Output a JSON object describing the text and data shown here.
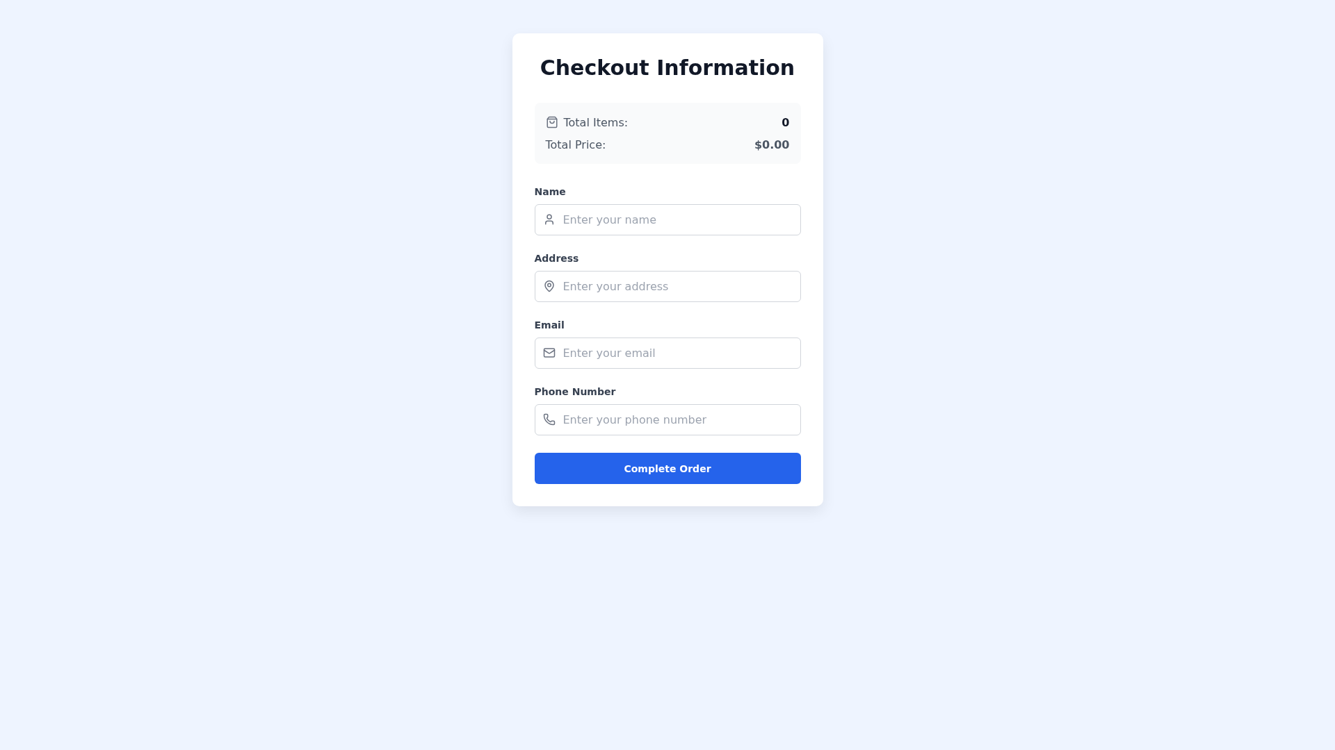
{
  "title": "Checkout Information",
  "summary": [
    {
      "kind": "items",
      "label": "Total Items:",
      "value": "0"
    },
    {
      "kind": "price",
      "label": "Total Price:",
      "value": "$0.00"
    }
  ],
  "fields": [
    {
      "kind": "name",
      "label": "Name",
      "placeholder": "Enter your name"
    },
    {
      "kind": "address",
      "label": "Address",
      "placeholder": "Enter your address"
    },
    {
      "kind": "email",
      "label": "Email",
      "placeholder": "Enter your email"
    },
    {
      "kind": "phone",
      "label": "Phone Number",
      "placeholder": "Enter your phone number"
    }
  ],
  "submit": "Complete Order"
}
